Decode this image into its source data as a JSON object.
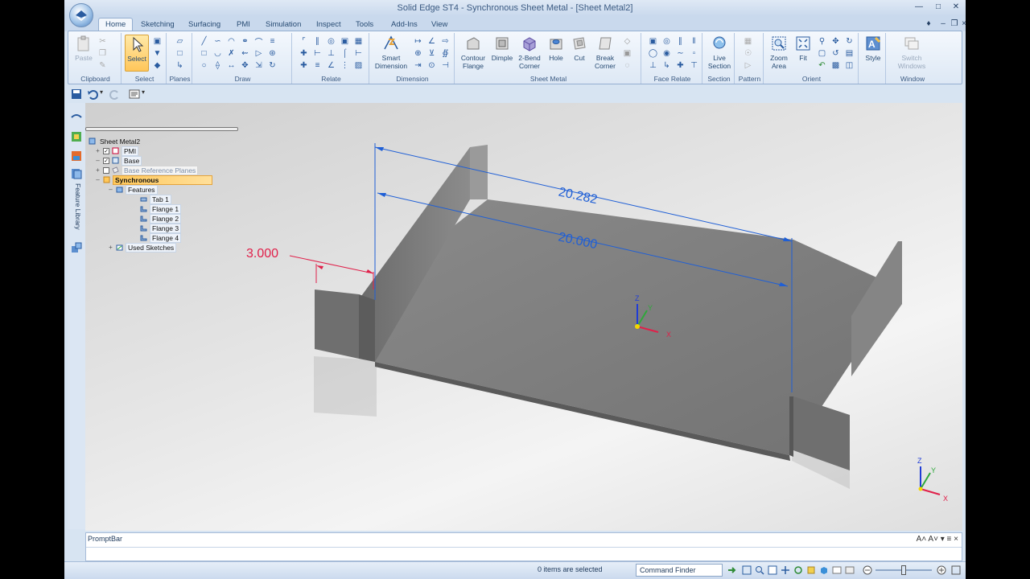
{
  "window": {
    "title": "Solid Edge ST4 - Synchronous Sheet Metal - [Sheet Metal2]"
  },
  "tabs": [
    "Home",
    "Sketching",
    "Surfacing",
    "PMI",
    "Simulation",
    "Inspect",
    "Tools",
    "Add-Ins",
    "View"
  ],
  "active_tab": "Home",
  "ribbon": {
    "clipboard": {
      "label": "Clipboard",
      "paste": "Paste"
    },
    "select": {
      "label": "Select",
      "select": "Select"
    },
    "planes": {
      "label": "Planes"
    },
    "draw": {
      "label": "Draw"
    },
    "relate": {
      "label": "Relate"
    },
    "dimension": {
      "label": "Dimension",
      "smart_1": "Smart",
      "smart_2": "Dimension"
    },
    "sheet_metal": {
      "label": "Sheet Metal",
      "contour_1": "Contour",
      "contour_2": "Flange",
      "dimple": "Dimple",
      "bend_1": "2-Bend",
      "bend_2": "Corner",
      "hole": "Hole",
      "cut": "Cut",
      "break_1": "Break",
      "break_2": "Corner"
    },
    "face_relate": {
      "label": "Face Relate"
    },
    "section": {
      "label": "Section",
      "live_1": "Live",
      "live_2": "Section"
    },
    "pattern": {
      "label": "Pattern"
    },
    "orient": {
      "label": "Orient",
      "zoom_1": "Zoom",
      "zoom_2": "Area",
      "fit": "Fit"
    },
    "style": {
      "label": "Style"
    },
    "window": {
      "label": "Window",
      "switch_1": "Switch",
      "switch_2": "Windows"
    }
  },
  "rail": {
    "feature_library": "Feature Library"
  },
  "tree": {
    "root": "Sheet Metal2",
    "pmi": "PMI",
    "base": "Base",
    "base_ref": "Base Reference Planes",
    "synchronous": "Synchronous",
    "features": "Features",
    "tab1": "Tab 1",
    "flange1": "Flange 1",
    "flange2": "Flange 2",
    "flange3": "Flange 3",
    "flange4": "Flange 4",
    "used_sketches": "Used Sketches"
  },
  "model": {
    "dim_outer": "20.282",
    "dim_inner": "20.000",
    "dim_flange": "3.000",
    "axis_x": "X",
    "axis_y": "Y",
    "axis_z": "Z"
  },
  "promptbar": {
    "title": "PromptBar"
  },
  "status": {
    "selection": "0 items are selected",
    "command_finder": "Command Finder"
  },
  "colors": {
    "dimension": "#1f5fd6",
    "driving_dimension": "#e0204a",
    "selection": "#ffc85a"
  }
}
